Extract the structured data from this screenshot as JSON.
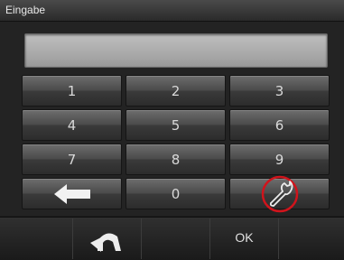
{
  "window": {
    "title": "Eingabe"
  },
  "display": {
    "value": ""
  },
  "keypad": {
    "keys": [
      "1",
      "2",
      "3",
      "4",
      "5",
      "6",
      "7",
      "8",
      "9",
      "0"
    ]
  },
  "icons": {
    "backspace": "arrow-left-icon",
    "settings": "wrench-icon",
    "back": "curved-arrow-back-icon"
  },
  "highlight": {
    "color": "#d0141c"
  },
  "bottom_bar": {
    "ok_label": "OK"
  }
}
